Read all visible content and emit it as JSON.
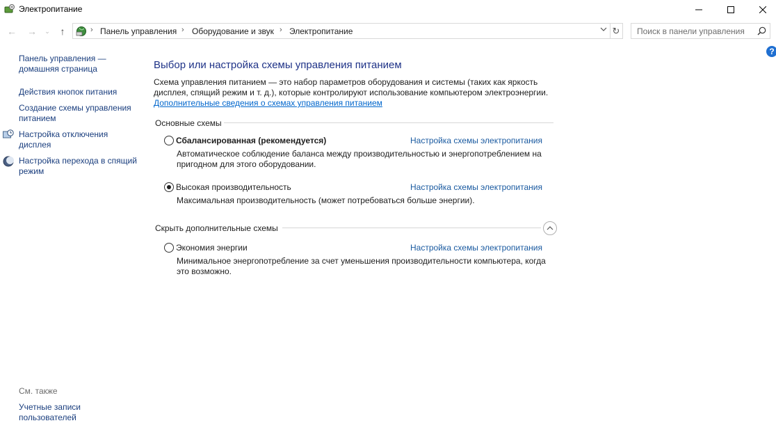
{
  "window": {
    "title": "Электропитание",
    "minimize_glyph": "—",
    "maximize_glyph": "☐",
    "close_glyph": "✕"
  },
  "nav": {
    "back_glyph": "←",
    "forward_glyph": "→",
    "recent_glyph": "⌄",
    "up_glyph": "↑",
    "breadcrumb": [
      "Панель управления",
      "Оборудование и звук",
      "Электропитание"
    ],
    "separator": "›",
    "refresh_glyph": "↻",
    "search_placeholder": "Поиск в панели управления"
  },
  "help": {
    "glyph": "?"
  },
  "sidebar": {
    "items": [
      {
        "label": "Панель управления — домашняя страница",
        "icon": null
      },
      {
        "label": "Действия кнопок питания",
        "icon": null
      },
      {
        "label": "Создание схемы управления питанием",
        "icon": null
      },
      {
        "label": "Настройка отключения дисплея",
        "icon": "display-clock-icon"
      },
      {
        "label": "Настройка перехода в спящий режим",
        "icon": "moon-icon"
      }
    ],
    "see_also_title": "См. также",
    "see_also_items": [
      "Учетные записи пользователей"
    ]
  },
  "main": {
    "title": "Выбор или настройка схемы управления питанием",
    "description": "Схема управления питанием — это набор параметров оборудования и системы (таких как яркость дисплея, спящий режим и т. д.), которые контролируют использование компьютером электроэнергии.",
    "more_link": "Дополнительные сведения о схемах управления питанием",
    "main_group_title": "Основные схемы",
    "hidden_group_title": "Скрыть дополнительные схемы",
    "plans": [
      {
        "name": "Сбалансированная (рекомендуется)",
        "bold": true,
        "selected": false,
        "link": "Настройка схемы электропитания",
        "description": "Автоматическое соблюдение баланса между производительностью и энергопотреблением на пригодном для этого оборудовании."
      },
      {
        "name": "Высокая производительность",
        "bold": false,
        "selected": true,
        "link": "Настройка схемы электропитания",
        "description": "Максимальная производительность (может потребоваться больше энергии)."
      },
      {
        "name": "Экономия энергии",
        "bold": false,
        "selected": false,
        "link": "Настройка схемы электропитания",
        "description": "Минимальное энергопотребление за счет уменьшения производительности компьютера, когда это возможно."
      }
    ]
  },
  "colors": {
    "link": "#1a5aa0",
    "title": "#1e3287",
    "help": "#1f6fd1"
  }
}
